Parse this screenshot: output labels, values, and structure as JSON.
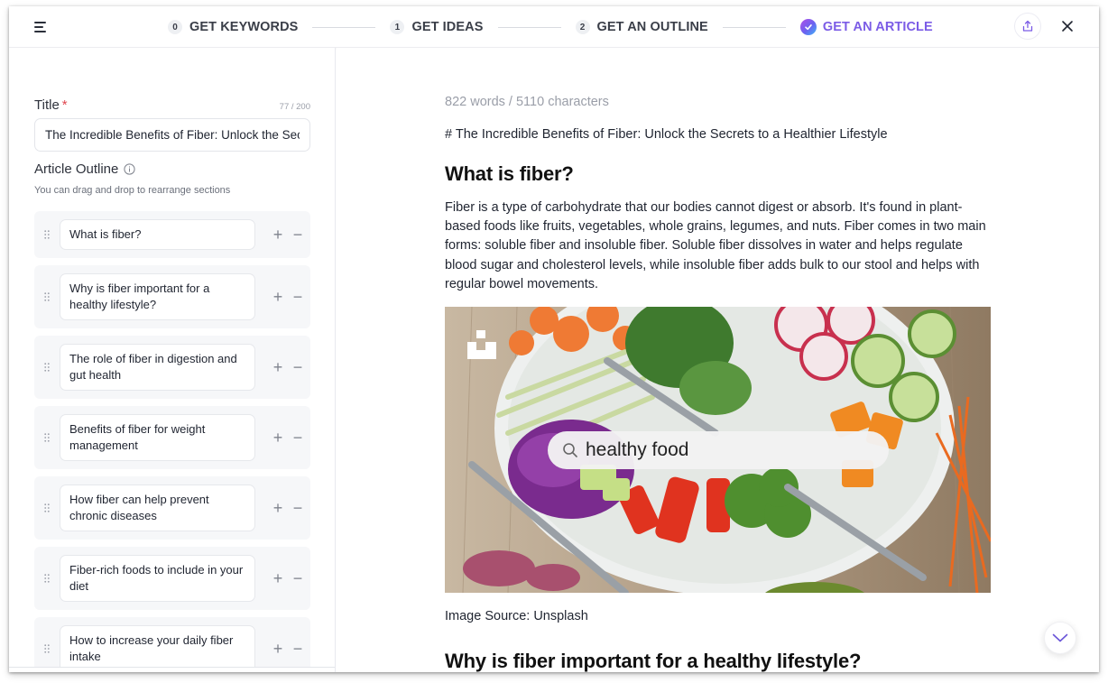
{
  "header": {
    "steps": [
      {
        "num": "0",
        "label": "GET KEYWORDS",
        "state": "done"
      },
      {
        "num": "1",
        "label": "GET IDEAS",
        "state": "done"
      },
      {
        "num": "2",
        "label": "GET AN OUTLINE",
        "state": "done"
      },
      {
        "num": "",
        "label": "GET AN ARTICLE",
        "state": "active"
      }
    ],
    "accent_color": "#7b5ce6",
    "icons": {
      "menu": "menu-icon",
      "share": "share-icon",
      "close": "close-icon",
      "check": "check-icon"
    }
  },
  "left_panel": {
    "title_label": "Title",
    "required_mark": "*",
    "title_counter": "77 / 200",
    "title_value": "The Incredible Benefits of Fiber: Unlock the Secrets to a Healthier Lifestyle",
    "outline_label": "Article Outline",
    "outline_hint": "You can drag and drop to rearrange sections",
    "outline_items": [
      "What is fiber?",
      "Why is fiber important for a healthy lifestyle?",
      "The role of fiber in digestion and gut health",
      "Benefits of fiber for weight management",
      "How fiber can help prevent chronic diseases",
      "Fiber-rich foods to include in your diet",
      "How to increase your daily fiber intake"
    ],
    "add_symbol": "+",
    "remove_symbol": "−"
  },
  "article": {
    "stats": "822 words / 5110 characters",
    "markdown_title": "# The Incredible Benefits of Fiber: Unlock the Secrets to a Healthier Lifestyle",
    "section1_heading": "What is fiber?",
    "section1_paragraph": "Fiber is a type of carbohydrate that our bodies cannot digest or absorb. It's found in plant-based foods like fruits, vegetables, whole grains, legumes, and nuts. Fiber comes in two main forms: soluble fiber and insoluble fiber. Soluble fiber dissolves in water and helps regulate blood sugar and cholesterol levels, while insoluble fiber adds bulk to our stool and helps with regular bowel movements.",
    "image_search_text": "healthy food",
    "image_caption": "Image Source: Unsplash",
    "section2_heading": "Why is fiber important for a healthy lifestyle?"
  }
}
